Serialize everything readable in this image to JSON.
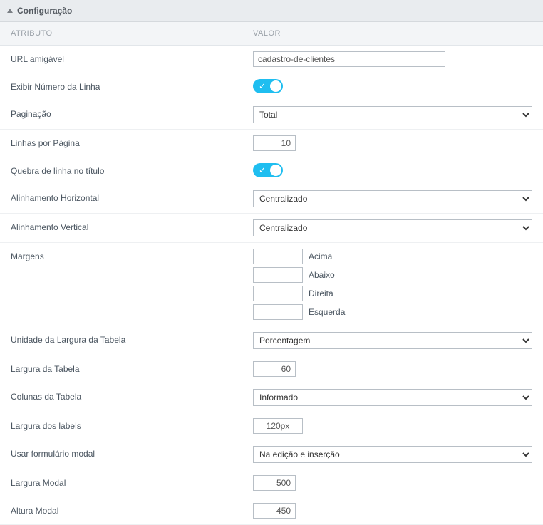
{
  "panel": {
    "title": "Configuração"
  },
  "columns": {
    "attr": "ATRIBUTO",
    "val": "VALOR"
  },
  "rows": {
    "url": {
      "label": "URL amigável",
      "value": "cadastro-de-clientes"
    },
    "showLineNumber": {
      "label": "Exibir Número da Linha"
    },
    "pagination": {
      "label": "Paginação",
      "value": "Total"
    },
    "linesPerPage": {
      "label": "Linhas por Página",
      "value": "10"
    },
    "titleLineBreak": {
      "label": "Quebra de linha no título"
    },
    "hAlign": {
      "label": "Alinhamento Horizontal",
      "value": "Centralizado"
    },
    "vAlign": {
      "label": "Alinhamento Vertical",
      "value": "Centralizado"
    },
    "margins": {
      "label": "Margens",
      "top": {
        "label": "Acima",
        "value": ""
      },
      "bottom": {
        "label": "Abaixo",
        "value": ""
      },
      "right": {
        "label": "Direita",
        "value": ""
      },
      "left": {
        "label": "Esquerda",
        "value": ""
      }
    },
    "tableWidthUnit": {
      "label": "Unidade da Largura da Tabela",
      "value": "Porcentagem"
    },
    "tableWidth": {
      "label": "Largura da Tabela",
      "value": "60"
    },
    "tableColumns": {
      "label": "Colunas da Tabela",
      "value": "Informado"
    },
    "labelWidth": {
      "label": "Largura dos labels",
      "value": "120px"
    },
    "modalForm": {
      "label": "Usar formulário modal",
      "value": "Na edição e inserção"
    },
    "modalWidth": {
      "label": "Largura Modal",
      "value": "500"
    },
    "modalHeight": {
      "label": "Altura Modal",
      "value": "450"
    }
  }
}
